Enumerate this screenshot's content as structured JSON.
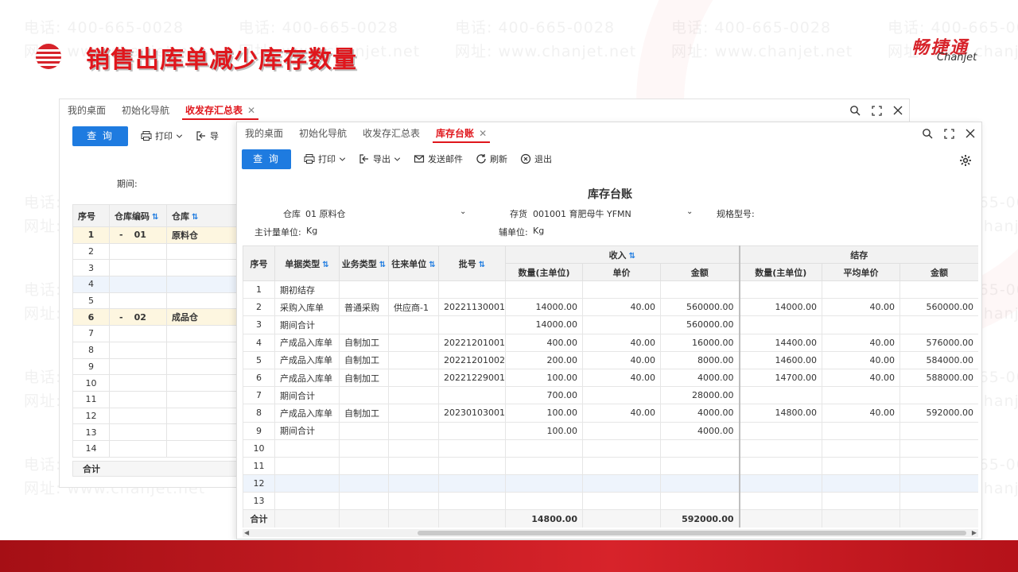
{
  "slide": {
    "title": "销售出库单减少库存数量",
    "brand_cn": "畅捷通",
    "brand_en": "Chanjet",
    "watermark_phone": "电话: 400-665-0028",
    "watermark_site": "网址: www.chanjet.net",
    "colors": {
      "accent": "#e0161c",
      "primary_button": "#1e7be0",
      "band": "#c4161c"
    }
  },
  "back_window": {
    "tabs": [
      {
        "label": "我的桌面"
      },
      {
        "label": "初始化导航"
      },
      {
        "label": "收发存汇总表",
        "active": true,
        "close": "✕"
      }
    ],
    "query_label": "查 询",
    "print_label": "打印",
    "export_label": "导",
    "period_label": "期间:",
    "columns": [
      "序号",
      "仓库编码",
      "仓库"
    ],
    "rows": [
      {
        "no": "1",
        "toggle": "-",
        "code": "01",
        "name": "原料仓",
        "style": "yel"
      },
      {
        "no": "2",
        "toggle": "",
        "code": "",
        "name": "",
        "style": ""
      },
      {
        "no": "3",
        "toggle": "",
        "code": "",
        "name": "",
        "style": ""
      },
      {
        "no": "4",
        "toggle": "",
        "code": "",
        "name": "",
        "style": "hl"
      },
      {
        "no": "5",
        "toggle": "",
        "code": "",
        "name": "",
        "style": ""
      },
      {
        "no": "6",
        "toggle": "-",
        "code": "02",
        "name": "成品仓",
        "style": "yel"
      },
      {
        "no": "7",
        "toggle": "",
        "code": "",
        "name": "",
        "style": ""
      },
      {
        "no": "8",
        "toggle": "",
        "code": "",
        "name": "",
        "style": ""
      },
      {
        "no": "9",
        "toggle": "",
        "code": "",
        "name": "",
        "style": ""
      },
      {
        "no": "10",
        "toggle": "",
        "code": "",
        "name": "",
        "style": ""
      },
      {
        "no": "11",
        "toggle": "",
        "code": "",
        "name": "",
        "style": ""
      },
      {
        "no": "12",
        "toggle": "",
        "code": "",
        "name": "",
        "style": ""
      },
      {
        "no": "13",
        "toggle": "",
        "code": "",
        "name": "",
        "style": ""
      },
      {
        "no": "14",
        "toggle": "",
        "code": "",
        "name": "",
        "style": ""
      }
    ],
    "footer_label": "合计"
  },
  "front_window": {
    "tabs": [
      {
        "label": "我的桌面"
      },
      {
        "label": "初始化导航"
      },
      {
        "label": "收发存汇总表"
      },
      {
        "label": "库存台账",
        "active": true,
        "close": "✕"
      }
    ],
    "toolbar": {
      "query": "查 询",
      "print": "打印",
      "export": "导出",
      "email": "发送邮件",
      "refresh": "刷新",
      "exit": "退出"
    },
    "report_title": "库存台账",
    "filters": {
      "warehouse_label": "仓库",
      "warehouse_value": "01 原料仓",
      "stock_label": "存货",
      "stock_value": "001001 育肥母牛 YFMN",
      "spec_label": "规格型号:",
      "main_unit_label": "主计量单位:",
      "main_unit_value": "Kg",
      "aux_unit_label": "辅单位:",
      "aux_unit_value": "Kg"
    },
    "header": {
      "no": "序号",
      "doc_type": "单据类型",
      "biz_type": "业务类型",
      "partner": "往来单位",
      "batch": "批号",
      "income_group": "收入",
      "balance_group": "结存",
      "in_qty": "数量(主单位)",
      "in_price": "单价",
      "in_amount": "金额",
      "bal_qty": "数量(主单位)",
      "bal_price": "平均单价",
      "bal_amount": "金额"
    },
    "rows": [
      {
        "no": "1",
        "doc": "期初结存",
        "biz": "",
        "partner": "",
        "batch": "",
        "in_qty": "",
        "in_price": "",
        "in_amt": "",
        "bal_qty": "",
        "bal_price": "",
        "bal_amt": "",
        "style": ""
      },
      {
        "no": "2",
        "doc": "采购入库单",
        "biz": "普通采购",
        "partner": "供应商-1",
        "batch": "20221130001",
        "in_qty": "14000.00",
        "in_price": "40.00",
        "in_amt": "560000.00",
        "bal_qty": "14000.00",
        "bal_price": "40.00",
        "bal_amt": "560000.00",
        "style": ""
      },
      {
        "no": "3",
        "doc": "期间合计",
        "biz": "",
        "partner": "",
        "batch": "",
        "in_qty": "14000.00",
        "in_price": "",
        "in_amt": "560000.00",
        "bal_qty": "",
        "bal_price": "",
        "bal_amt": "",
        "style": ""
      },
      {
        "no": "4",
        "doc": "产成品入库单",
        "biz": "自制加工",
        "partner": "",
        "batch": "20221201001",
        "in_qty": "400.00",
        "in_price": "40.00",
        "in_amt": "16000.00",
        "bal_qty": "14400.00",
        "bal_price": "40.00",
        "bal_amt": "576000.00",
        "style": ""
      },
      {
        "no": "5",
        "doc": "产成品入库单",
        "biz": "自制加工",
        "partner": "",
        "batch": "20221201002",
        "in_qty": "200.00",
        "in_price": "40.00",
        "in_amt": "8000.00",
        "bal_qty": "14600.00",
        "bal_price": "40.00",
        "bal_amt": "584000.00",
        "style": ""
      },
      {
        "no": "6",
        "doc": "产成品入库单",
        "biz": "自制加工",
        "partner": "",
        "batch": "20221229001",
        "in_qty": "100.00",
        "in_price": "40.00",
        "in_amt": "4000.00",
        "bal_qty": "14700.00",
        "bal_price": "40.00",
        "bal_amt": "588000.00",
        "style": ""
      },
      {
        "no": "7",
        "doc": "期间合计",
        "biz": "",
        "partner": "",
        "batch": "",
        "in_qty": "700.00",
        "in_price": "",
        "in_amt": "28000.00",
        "bal_qty": "",
        "bal_price": "",
        "bal_amt": "",
        "style": ""
      },
      {
        "no": "8",
        "doc": "产成品入库单",
        "biz": "自制加工",
        "partner": "",
        "batch": "20230103001",
        "in_qty": "100.00",
        "in_price": "40.00",
        "in_amt": "4000.00",
        "bal_qty": "14800.00",
        "bal_price": "40.00",
        "bal_amt": "592000.00",
        "style": ""
      },
      {
        "no": "9",
        "doc": "期间合计",
        "biz": "",
        "partner": "",
        "batch": "",
        "in_qty": "100.00",
        "in_price": "",
        "in_amt": "4000.00",
        "bal_qty": "",
        "bal_price": "",
        "bal_amt": "",
        "style": ""
      },
      {
        "no": "10",
        "doc": "",
        "biz": "",
        "partner": "",
        "batch": "",
        "in_qty": "",
        "in_price": "",
        "in_amt": "",
        "bal_qty": "",
        "bal_price": "",
        "bal_amt": "",
        "style": ""
      },
      {
        "no": "11",
        "doc": "",
        "biz": "",
        "partner": "",
        "batch": "",
        "in_qty": "",
        "in_price": "",
        "in_amt": "",
        "bal_qty": "",
        "bal_price": "",
        "bal_amt": "",
        "style": ""
      },
      {
        "no": "12",
        "doc": "",
        "biz": "",
        "partner": "",
        "batch": "",
        "in_qty": "",
        "in_price": "",
        "in_amt": "",
        "bal_qty": "",
        "bal_price": "",
        "bal_amt": "",
        "style": "hl"
      },
      {
        "no": "13",
        "doc": "",
        "biz": "",
        "partner": "",
        "batch": "",
        "in_qty": "",
        "in_price": "",
        "in_amt": "",
        "bal_qty": "",
        "bal_price": "",
        "bal_amt": "",
        "style": ""
      }
    ],
    "footer": {
      "label": "合计",
      "in_qty": "14800.00",
      "in_amt": "592000.00"
    }
  }
}
